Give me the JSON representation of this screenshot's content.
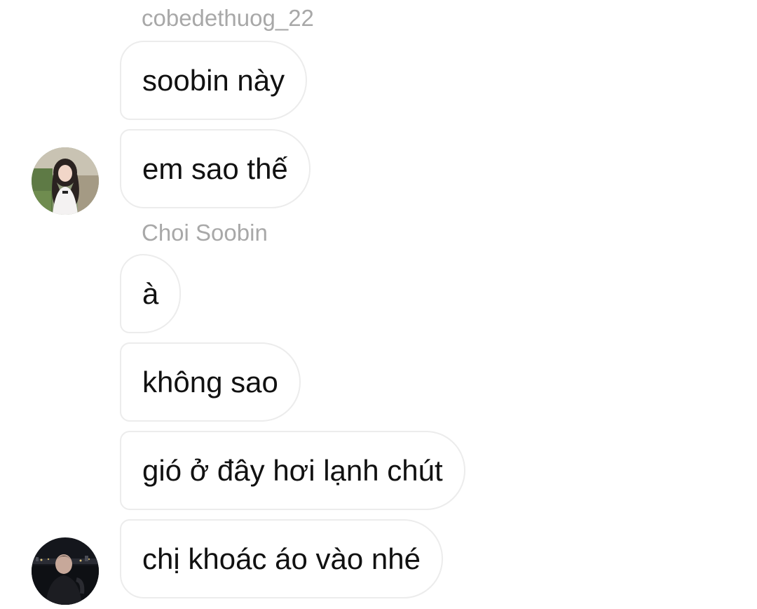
{
  "groups": [
    {
      "sender": "cobedethuog_22",
      "avatar": "girl-photo-avatar",
      "messages": [
        "soobin này",
        "em sao thế"
      ]
    },
    {
      "sender": "Choi Soobin",
      "avatar": "night-city-photo-avatar",
      "messages": [
        "à",
        "không sao",
        "gió ở đây hơi lạnh chút",
        "chị khoác áo vào nhé"
      ]
    }
  ]
}
